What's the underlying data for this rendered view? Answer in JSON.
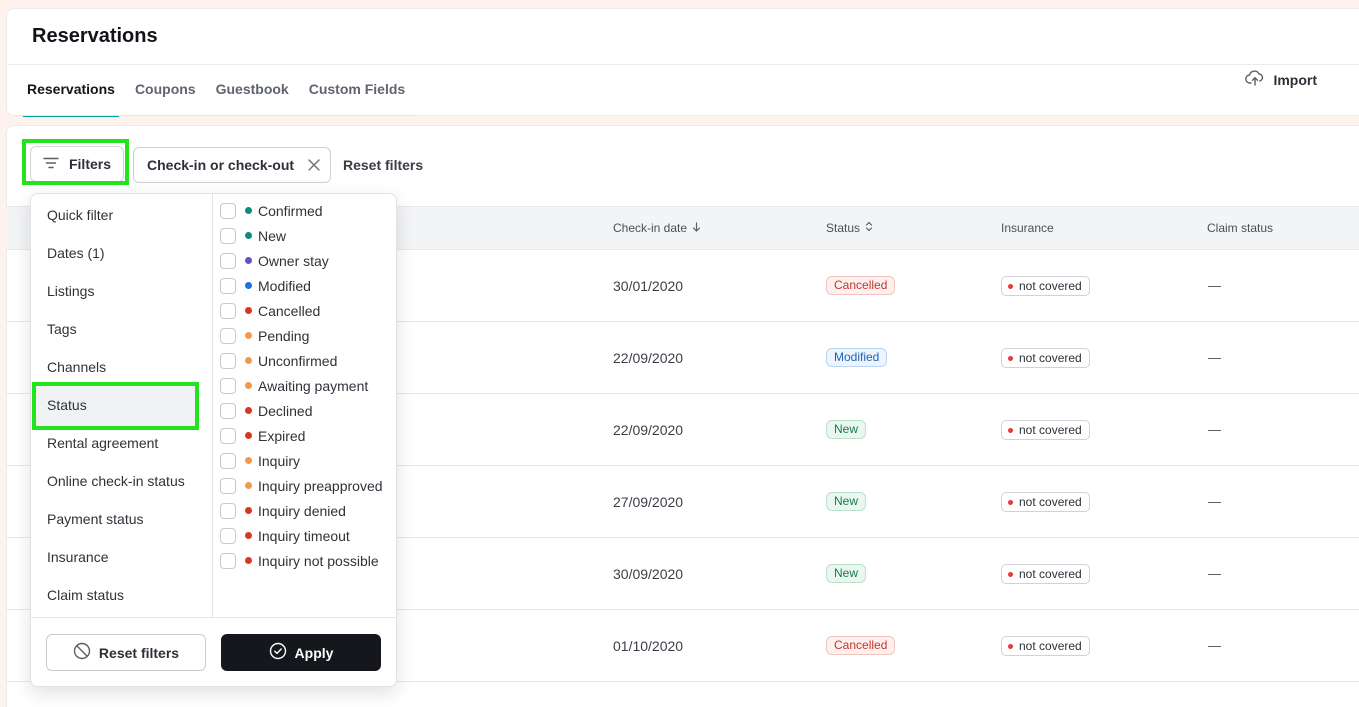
{
  "page": {
    "title": "Reservations"
  },
  "tabs": [
    {
      "label": "Reservations",
      "active": true
    },
    {
      "label": "Coupons"
    },
    {
      "label": "Guestbook"
    },
    {
      "label": "Custom Fields"
    }
  ],
  "import": {
    "label": "Import",
    "icon": "cloud-upload-icon"
  },
  "toolbar": {
    "filters_label": "Filters",
    "chip_label": "Check-in or check-out",
    "reset_label": "Reset filters"
  },
  "table": {
    "headers": {
      "checkin": "Check-in date",
      "status": "Status",
      "insurance": "Insurance",
      "claim": "Claim status"
    },
    "rows": [
      {
        "checkin": "30/01/2020",
        "status": "Cancelled",
        "status_color": "red",
        "insurance": "not covered",
        "claim": "—"
      },
      {
        "checkin": "22/09/2020",
        "status": "Modified",
        "status_color": "blue",
        "insurance": "not covered",
        "claim": "—"
      },
      {
        "checkin": "22/09/2020",
        "status": "New",
        "status_color": "green",
        "insurance": "not covered",
        "claim": "—"
      },
      {
        "checkin": "27/09/2020",
        "status": "New",
        "status_color": "green",
        "insurance": "not covered",
        "claim": "—"
      },
      {
        "checkin": "30/09/2020",
        "status": "New",
        "status_color": "green",
        "insurance": "not covered",
        "claim": "—"
      },
      {
        "checkin": "01/10/2020",
        "status": "Cancelled",
        "status_color": "red",
        "insurance": "not covered",
        "claim": "—"
      }
    ]
  },
  "filter_panel": {
    "categories": [
      "Quick filter",
      "Dates (1)",
      "Listings",
      "Tags",
      "Channels",
      "Status",
      "Rental agreement",
      "Online check-in status",
      "Payment status",
      "Insurance",
      "Claim status"
    ],
    "selected_category": "Status",
    "statuses": [
      {
        "label": "Confirmed",
        "color": "#0f8a7e"
      },
      {
        "label": "New",
        "color": "#0f8a7e"
      },
      {
        "label": "Owner stay",
        "color": "#6a4fc8"
      },
      {
        "label": "Modified",
        "color": "#1f6fe0"
      },
      {
        "label": "Cancelled",
        "color": "#d8381f"
      },
      {
        "label": "Pending",
        "color": "#f2994a"
      },
      {
        "label": "Unconfirmed",
        "color": "#f2994a"
      },
      {
        "label": "Awaiting payment",
        "color": "#f2994a"
      },
      {
        "label": "Declined",
        "color": "#d8381f"
      },
      {
        "label": "Expired",
        "color": "#d8381f"
      },
      {
        "label": "Inquiry",
        "color": "#f2994a"
      },
      {
        "label": "Inquiry preapproved",
        "color": "#f2994a"
      },
      {
        "label": "Inquiry denied",
        "color": "#d8381f"
      },
      {
        "label": "Inquiry timeout",
        "color": "#d8381f"
      },
      {
        "label": "Inquiry not possible",
        "color": "#d8381f"
      }
    ],
    "reset_label": "Reset filters",
    "apply_label": "Apply"
  }
}
